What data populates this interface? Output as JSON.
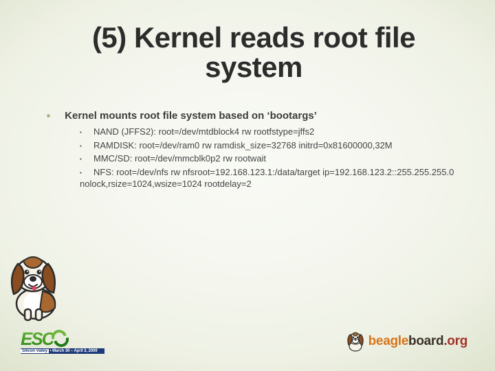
{
  "title": "(5) Kernel reads root file system",
  "body": {
    "lead": "Kernel mounts root file system based on ‘bootargs’",
    "items": [
      "NAND (JFFS2): root=/dev/mtdblock4 rw rootfstype=jffs2",
      "RAMDISK: root=/dev/ram0 rw ramdisk_size=32768 initrd=0x81600000,32M",
      "MMC/SD: root=/dev/mmcblk0p2 rw rootwait",
      "NFS: root=/dev/nfs rw nfsroot=192.168.123.1:/data/target ip=192.168.123.2::255.255.255.0 nolock,rsize=1024,wsize=1024 rootdelay=2"
    ]
  },
  "footer": {
    "esc": {
      "letters": "ESC",
      "band_sv": "Silicon Valley",
      "band_dates": " • March 30 – April 3, 2009"
    },
    "beagleboard": {
      "beagle": "beagle",
      "board": "board",
      "org": ".org"
    }
  }
}
